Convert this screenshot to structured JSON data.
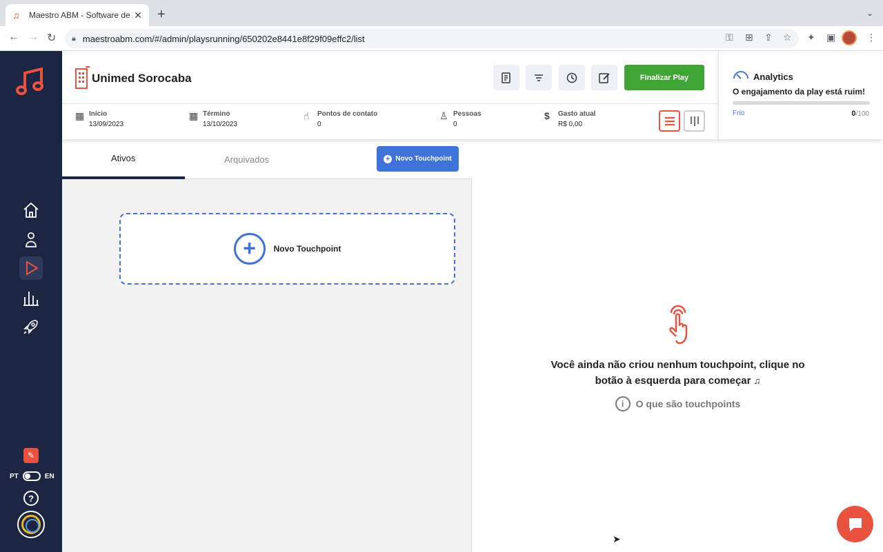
{
  "browser": {
    "tab_title": "Maestro ABM - Software de A",
    "url": "maestroabm.com/#/admin/playsrunning/650202e8441e8f29f09effc2/list"
  },
  "sidebar": {
    "lang_left": "PT",
    "lang_right": "EN",
    "help": "?"
  },
  "header": {
    "company": "Unimed Sorocaba",
    "finalize_label": "Finalizar Play",
    "stats": [
      {
        "label": "Início",
        "value": "13/09/2023",
        "icon": "calendar-icon"
      },
      {
        "label": "Término",
        "value": "13/10/2023",
        "icon": "calendar-icon"
      },
      {
        "label": "Pontos de contato",
        "value": "0",
        "icon": "touch-icon"
      },
      {
        "label": "Pessoas",
        "value": "0",
        "icon": "person-icon"
      },
      {
        "label": "Gasto atual",
        "value": "R$ 0,00",
        "icon": "dollar-icon"
      }
    ]
  },
  "analytics": {
    "title": "Analytics",
    "message": "O engajamento da play está ruim!",
    "low_label": "Frio",
    "score": "0",
    "max": "/100",
    "progress": 0
  },
  "left": {
    "tab_active": "Ativos",
    "tab_archived": "Arquivados",
    "new_button": "Novo Touchpoint",
    "card_label": "Novo Touchpoint"
  },
  "right": {
    "empty_line1": "Você ainda não criou nenhum touchpoint, clique no",
    "empty_line2": "botão à esquerda para começar",
    "help_link": "O que são touchpoints"
  },
  "colors": {
    "sidebar": "#1c2541",
    "accent_red": "#e8523f",
    "accent_blue": "#3f73d9",
    "accent_green": "#3fa535"
  }
}
